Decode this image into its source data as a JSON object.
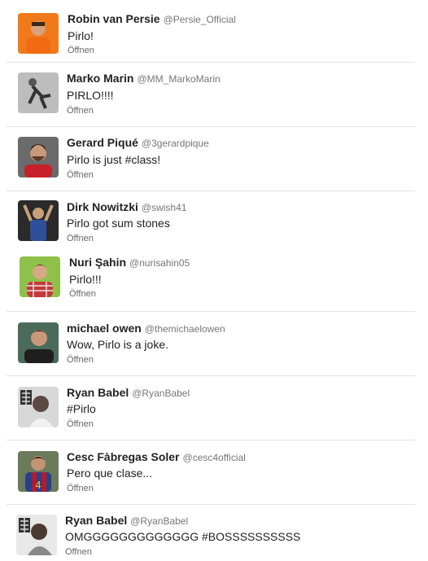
{
  "tweets": [
    {
      "name": "Robin van Persie",
      "handle": "@Persie_Official",
      "text": "Pirlo!",
      "action": "Öffnen",
      "colors": {
        "bg": "#f07a1a",
        "skin": "#d8a27a",
        "shirt": "#f26a12"
      }
    },
    {
      "name": "Marko Marin",
      "handle": "@MM_MarkoMarin",
      "text": "PIRLO!!!!",
      "action": "Öffnen",
      "colors": {
        "bg": "#9a9a9a",
        "skin": "#555555",
        "shirt": "#333333"
      }
    },
    {
      "name": "Gerard Piqué",
      "handle": "@3gerardpique",
      "text": "Pirlo is just #class!",
      "action": "Öffnen",
      "colors": {
        "bg": "#6b6b6b",
        "skin": "#c99a7a",
        "shirt": "#c8202a"
      }
    },
    {
      "name": "Dirk Nowitzki",
      "handle": "@swish41",
      "text": "Pirlo got sum stones",
      "action": "Öffnen",
      "colors": {
        "bg": "#2a2a2a",
        "skin": "#c9a07a",
        "shirt": "#2f4f9a"
      }
    },
    {
      "name": "Nuri Şahin",
      "handle": "@nurisahin05",
      "text": "Pirlo!!!",
      "action": "Öffnen",
      "colors": {
        "bg": "#8fc04a",
        "skin": "#d6a885",
        "shirt": "#c23a3a"
      }
    },
    {
      "name": "michael owen",
      "handle": "@themichaelowen",
      "text": "Wow, Pirlo is a joke.",
      "action": "Öffnen",
      "colors": {
        "bg": "#4a6a5a",
        "skin": "#c9987a",
        "shirt": "#1e1e1e"
      }
    },
    {
      "name": "Ryan Babel",
      "handle": "@RyanBabel",
      "text": "#Pirlo",
      "action": "Öffnen",
      "colors": {
        "bg": "#d8d8d8",
        "skin": "#5a4a40",
        "shirt": "#f2f2f2"
      }
    },
    {
      "name": "Cesc Fàbregas Soler",
      "handle": "@cesc4official",
      "text": "Pero que clase...",
      "action": "Öffnen",
      "colors": {
        "bg": "#6a7a5a",
        "skin": "#c49474",
        "shirt": "#2a3f8a"
      }
    },
    {
      "name": "Ryan Babel",
      "handle": "@RyanBabel",
      "text": "OMGGGGGGGGGGGGG #BOSSSSSSSSSS",
      "action": "Öffnen",
      "colors": {
        "bg": "#e8e8e8",
        "skin": "#4a3a30",
        "shirt": "#888888"
      }
    }
  ]
}
